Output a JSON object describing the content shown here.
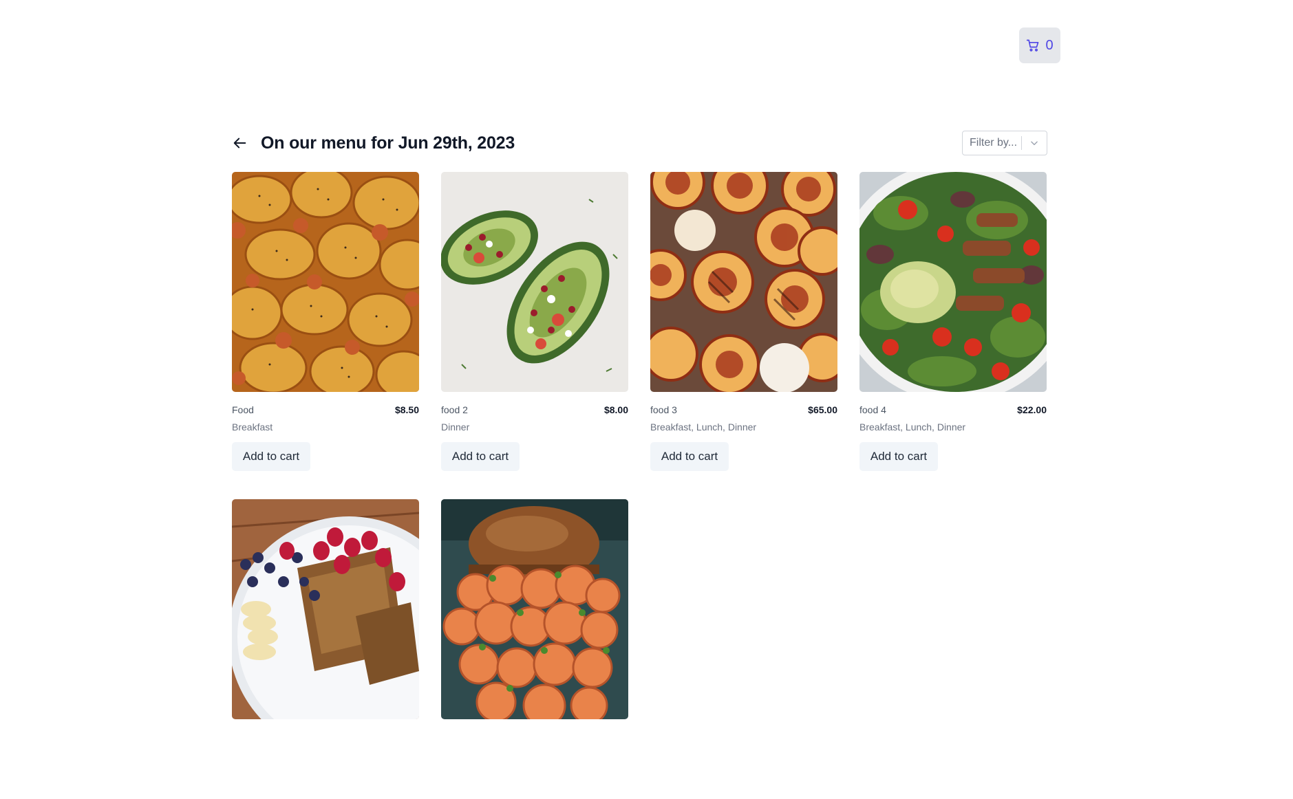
{
  "cart": {
    "count": "0",
    "icon": "cart-icon"
  },
  "header": {
    "title": "On our menu for Jun 29th, 2023",
    "back_icon": "arrow-left-icon"
  },
  "filter": {
    "placeholder": "Filter by...",
    "icon": "chevron-down-icon"
  },
  "items": [
    {
      "name": "Food",
      "price": "$8.50",
      "categories": "Breakfast",
      "button": "Add to cart",
      "image": "pigs-in-blanket-photo"
    },
    {
      "name": "food 2",
      "price": "$8.00",
      "categories": "Dinner",
      "button": "Add to cart",
      "image": "stuffed-avocado-photo"
    },
    {
      "name": "food 3",
      "price": "$65.00",
      "categories": "Breakfast, Lunch, Dinner",
      "button": "Add to cart",
      "image": "grilled-peaches-photo"
    },
    {
      "name": "food 4",
      "price": "$22.00",
      "categories": "Breakfast, Lunch, Dinner",
      "button": "Add to cart",
      "image": "chicken-salad-photo"
    },
    {
      "image": "french-toast-berries-photo"
    },
    {
      "image": "shrimp-burger-photo"
    }
  ],
  "colors": {
    "accent": "#4f46e5",
    "button_bg": "#f1f5f9",
    "cart_bg": "#e5e7eb"
  }
}
